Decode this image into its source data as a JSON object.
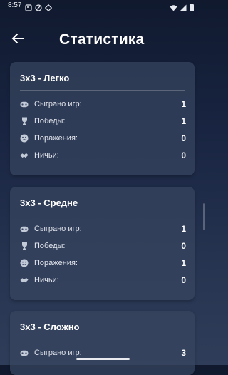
{
  "status_bar": {
    "time": "8:57"
  },
  "header": {
    "title": "Статистика"
  },
  "cards": [
    {
      "title": "3x3 - Легко",
      "stats": [
        {
          "label": "Сыграно игр:",
          "value": "1"
        },
        {
          "label": "Победы:",
          "value": "1"
        },
        {
          "label": "Поражения:",
          "value": "0"
        },
        {
          "label": "Ничьи:",
          "value": "0"
        }
      ]
    },
    {
      "title": "3x3 - Средне",
      "stats": [
        {
          "label": "Сыграно игр:",
          "value": "1"
        },
        {
          "label": "Победы:",
          "value": "0"
        },
        {
          "label": "Поражения:",
          "value": "1"
        },
        {
          "label": "Ничьи:",
          "value": "0"
        }
      ]
    },
    {
      "title": "3x3 - Сложно",
      "stats": [
        {
          "label": "Сыграно игр:",
          "value": "3"
        }
      ]
    }
  ],
  "icons": {
    "played": "gamepad-icon",
    "wins": "trophy-icon",
    "losses": "sad-face-icon",
    "draws": "handshake-icon"
  },
  "colors": {
    "background_top": "#10192e",
    "background_bottom": "#2f3d5a",
    "card": "#38455f"
  }
}
